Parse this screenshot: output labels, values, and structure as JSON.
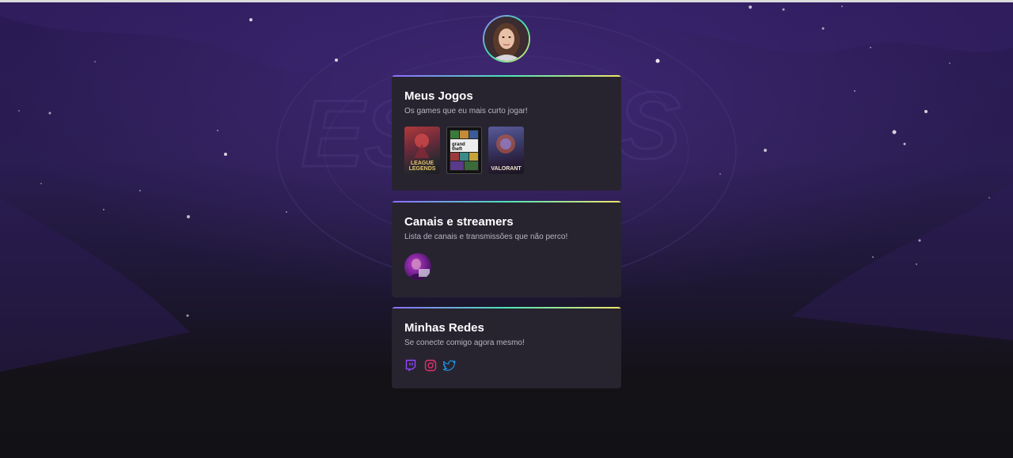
{
  "profile": {
    "avatar_icon": "profile-avatar"
  },
  "games_card": {
    "title": "Meus Jogos",
    "subtitle": "Os games que eu mais curto jogar!",
    "games": [
      {
        "name": "League of Legends",
        "label_line1": "LEAGUE",
        "label_line2": "LEGENDS"
      },
      {
        "name": "Grand Theft Auto V",
        "label_line1": "grand",
        "label_line2": "theft auto"
      },
      {
        "name": "Valorant",
        "label_line1": "VALORANT",
        "label_line2": ""
      }
    ]
  },
  "channels_card": {
    "title": "Canais e streamers",
    "subtitle": "Lista de canais e transmissões que não perco!",
    "channels": [
      {
        "icon": "streamer-avatar"
      }
    ]
  },
  "socials_card": {
    "title": "Minhas Redes",
    "subtitle": "Se conecte comigo agora mesmo!",
    "links": [
      {
        "icon": "twitch-icon",
        "color": "#9146ff"
      },
      {
        "icon": "instagram-icon",
        "color": "#e1306c"
      },
      {
        "icon": "twitter-icon",
        "color": "#1d9bf0"
      }
    ]
  },
  "colors": {
    "card_bg": "#272430",
    "accent_gradient": [
      "#8b6cff",
      "#4fe3b7",
      "#f2e56b"
    ]
  }
}
